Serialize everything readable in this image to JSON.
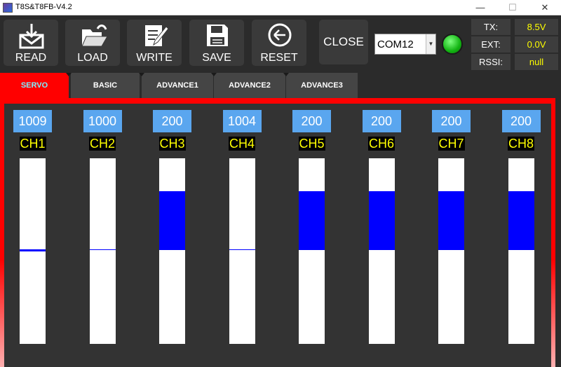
{
  "window": {
    "title": "T8S&T8FB-V4.2",
    "min": "—",
    "max": "☐",
    "close": "✕"
  },
  "toolbar": {
    "read": "READ",
    "load": "LOAD",
    "write": "WRITE",
    "save": "SAVE",
    "reset": "RESET",
    "close": "CLOSE",
    "port": "COM12",
    "connected_color": "#12b312"
  },
  "status": {
    "tx_label": "TX:",
    "tx_value": "8.5V",
    "ext_label": "EXT:",
    "ext_value": "0.0V",
    "rssi_label": "RSSI:",
    "rssi_value": "null"
  },
  "tabs": [
    "SERVO",
    "BASIC",
    "ADVANCE1",
    "ADVANCE2",
    "ADVANCE3"
  ],
  "active_tab": "SERVO",
  "channels": [
    {
      "name": "CH1",
      "value": "1009",
      "level": 0.5
    },
    {
      "name": "CH2",
      "value": "1000",
      "level": 0.5
    },
    {
      "name": "CH3",
      "value": "200",
      "level": 0.9
    },
    {
      "name": "CH4",
      "value": "1004",
      "level": 0.5
    },
    {
      "name": "CH5",
      "value": "200",
      "level": 0.9
    },
    {
      "name": "CH6",
      "value": "200",
      "level": 0.9
    },
    {
      "name": "CH7",
      "value": "200",
      "level": 0.9
    },
    {
      "name": "CH8",
      "value": "200",
      "level": 0.9
    }
  ]
}
